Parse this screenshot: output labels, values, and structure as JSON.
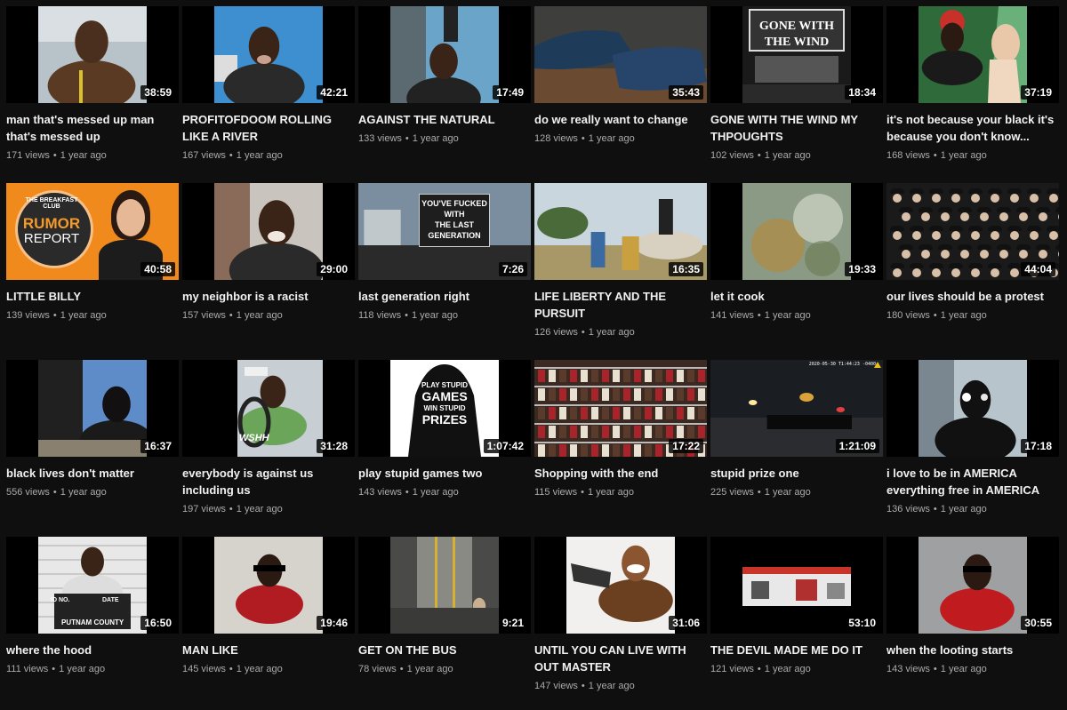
{
  "videos": [
    {
      "title": "man that's messed up man that's messed up",
      "duration": "38:59",
      "views": "171 views",
      "age": "1 year ago",
      "thumb": "portrait-outdoor",
      "bg": "#b7c2c9",
      "accent": "#5a3a22"
    },
    {
      "title": "PROFITOFDOOM ROLLING LIKE A RIVER",
      "duration": "42:21",
      "views": "167 views",
      "age": "1 year ago",
      "thumb": "portrait-sky",
      "bg": "#3e8fd0",
      "accent": "#3a2a20"
    },
    {
      "title": "AGAINST THE NATURAL",
      "duration": "17:49",
      "views": "133 views",
      "age": "1 year ago",
      "thumb": "portrait-street",
      "bg": "#6aa4c8",
      "accent": "#3a2a20"
    },
    {
      "title": "do we really want to change",
      "duration": "35:43",
      "views": "128 views",
      "age": "1 year ago",
      "thumb": "shoes",
      "bg": "#4a4a48",
      "accent": "#1f3b5a"
    },
    {
      "title": "GONE WITH THE WIND MY THPOUGHTS",
      "duration": "18:34",
      "views": "102 views",
      "age": "1 year ago",
      "thumb": "marquee",
      "bg": "#1a1a1a",
      "accent": "#ffffff"
    },
    {
      "title": "it's not because your black it's because you don't know...",
      "duration": "37:19",
      "views": "168 views",
      "age": "1 year ago",
      "thumb": "poster",
      "bg": "#2f6a3a",
      "accent": "#c8302a"
    },
    {
      "title": "LITTLE BILLY",
      "duration": "40:58",
      "views": "139 views",
      "age": "1 year ago",
      "thumb": "rumor",
      "bg": "#f08a1c",
      "accent": "#2a2a2a"
    },
    {
      "title": "my neighbor is a racist",
      "duration": "29:00",
      "views": "157 views",
      "age": "1 year ago",
      "thumb": "portrait-laugh",
      "bg": "#c9c4bd",
      "accent": "#3a2a20"
    },
    {
      "title": "last generation right",
      "duration": "7:26",
      "views": "118 views",
      "age": "1 year ago",
      "thumb": "protest-sign",
      "bg": "#7a8ea0",
      "accent": "#222"
    },
    {
      "title": "LIFE LIBERTY AND THE PURSUIT",
      "duration": "16:35",
      "views": "126 views",
      "age": "1 year ago",
      "thumb": "painting",
      "bg": "#c9d6de",
      "accent": "#6b5030"
    },
    {
      "title": "let it cook",
      "duration": "19:33",
      "views": "141 views",
      "age": "1 year ago",
      "thumb": "blur",
      "bg": "#8a9a84",
      "accent": "#b08a40"
    },
    {
      "title": "our lives should be a protest",
      "duration": "44:04",
      "views": "180 views",
      "age": "1 year ago",
      "thumb": "crowd",
      "bg": "#2a2a2a",
      "accent": "#d8c8b0"
    },
    {
      "title": "black lives don't matter",
      "duration": "16:37",
      "views": "556 views",
      "age": "1 year ago",
      "thumb": "dark-selfie",
      "bg": "#5d8cc8",
      "accent": "#1a1a1a"
    },
    {
      "title": "everybody is against us including us",
      "duration": "31:28",
      "views": "197 views",
      "age": "1 year ago",
      "thumb": "car-selfie",
      "bg": "#c8cfd4",
      "accent": "#6aa55a"
    },
    {
      "title": "play stupid games two",
      "duration": "1:07:42",
      "views": "143 views",
      "age": "1 year ago",
      "thumb": "hoodie",
      "bg": "#ffffff",
      "accent": "#111"
    },
    {
      "title": "Shopping with the end",
      "duration": "17:22",
      "views": "115 views",
      "age": "1 year ago",
      "thumb": "shelves",
      "bg": "#3a2a22",
      "accent": "#a8242a"
    },
    {
      "title": "stupid prize one",
      "duration": "1:21:09",
      "views": "225 views",
      "age": "1 year ago",
      "thumb": "night-cam",
      "bg": "#1a1d22",
      "accent": "#d9a23a"
    },
    {
      "title": "i love to be in AMERICA everything free in AMERICA",
      "duration": "17:18",
      "views": "136 views",
      "age": "1 year ago",
      "thumb": "mask",
      "bg": "#b8c4cc",
      "accent": "#111"
    },
    {
      "title": "where the hood",
      "duration": "16:50",
      "views": "111 views",
      "age": "1 year ago",
      "thumb": "mugshot",
      "bg": "#e8e8e8",
      "accent": "#222"
    },
    {
      "title": "MAN LIKE",
      "duration": "19:46",
      "views": "145 views",
      "age": "1 year ago",
      "thumb": "portrait-red",
      "bg": "#d6d2cc",
      "accent": "#b01c22"
    },
    {
      "title": "GET ON THE BUS",
      "duration": "9:21",
      "views": "78 views",
      "age": "1 year ago",
      "thumb": "bus",
      "bg": "#4a4a48",
      "accent": "#d8b030"
    },
    {
      "title": "UNTIL YOU CAN LIVE WITH OUT MASTER",
      "duration": "31:06",
      "views": "147 views",
      "age": "1 year ago",
      "thumb": "gun-boy",
      "bg": "#f2f0ee",
      "accent": "#8a5530"
    },
    {
      "title": "THE DEVIL MADE ME DO IT",
      "duration": "53:10",
      "views": "121 views",
      "age": "1 year ago",
      "thumb": "store-strip",
      "bg": "#000",
      "accent": "#c8342a"
    },
    {
      "title": "when the looting starts",
      "duration": "30:55",
      "views": "143 views",
      "age": "1 year ago",
      "thumb": "glasses",
      "bg": "#9ea0a2",
      "accent": "#c01c20"
    }
  ],
  "thumb_text": {
    "marquee": "GONE WITH THE WIND",
    "rumor_club": "THE BREAKFAST CLUB",
    "rumor_1": "RUMOR",
    "rumor_2": "REPORT",
    "sign_1": "YOU'VE FUCKED",
    "sign_2": "WITH",
    "sign_3": "THE LAST",
    "sign_4": "GENERATION",
    "hoodie_1": "PLAY STUPID",
    "hoodie_2": "GAMES",
    "hoodie_3": "WIN STUPID",
    "hoodie_4": "PRIZES",
    "wshh": "WSHH",
    "mug_1": "ID NO.",
    "mug_2": "DATE",
    "mug_3": "PUTNAM COUNTY",
    "cam_stamp": "2020-05-30 T1:44:23 -0400"
  }
}
